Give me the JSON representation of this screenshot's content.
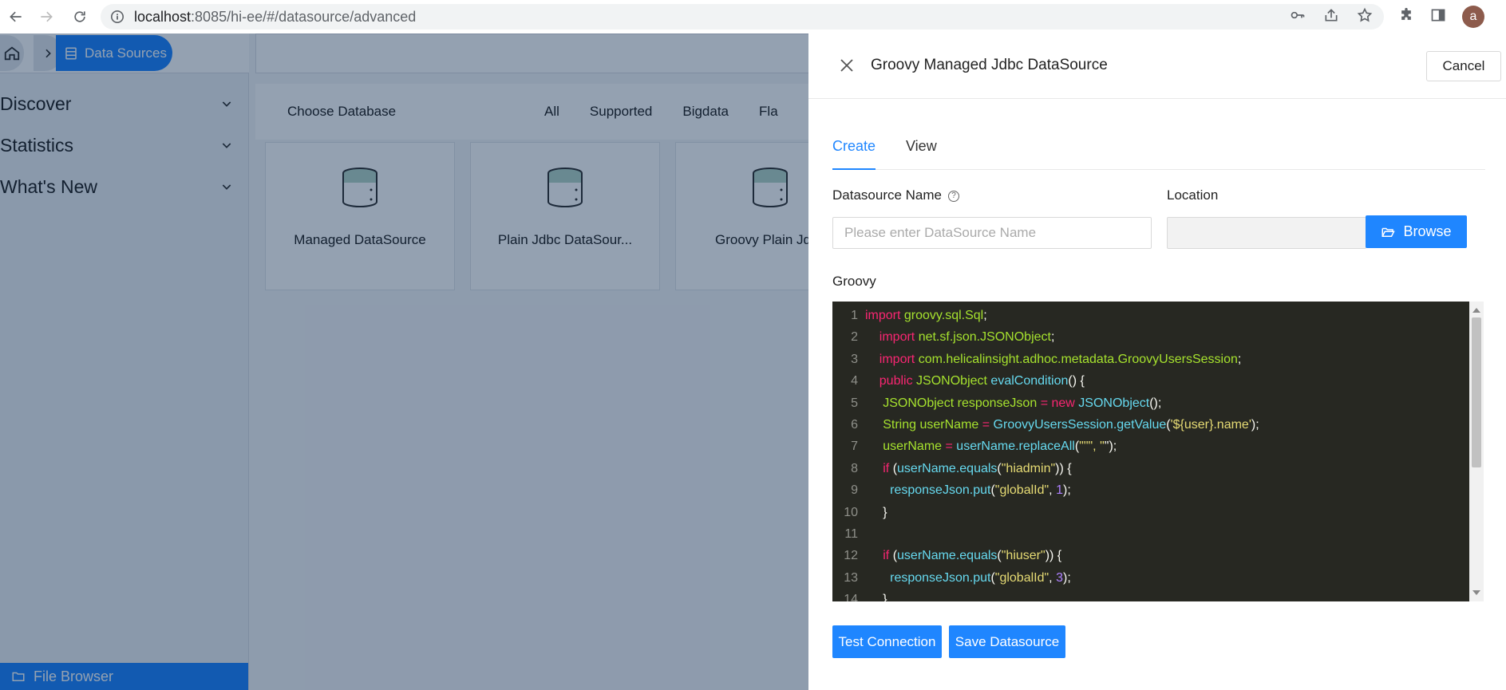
{
  "browser": {
    "url_host": "localhost",
    "url_path": ":8085/hi-ee/#/datasource/advanced",
    "profile_initial": "a"
  },
  "app": {
    "breadcrumb": {
      "active_label": "Data Sources"
    },
    "sidebar": {
      "items": [
        {
          "label": "Discover"
        },
        {
          "label": "Statistics"
        },
        {
          "label": "What's New"
        }
      ],
      "footer_label": "File Browser"
    },
    "main": {
      "choose_label": "Choose Database",
      "filters": [
        "All",
        "Supported",
        "Bigdata",
        "Fla"
      ],
      "cards": [
        {
          "name": "Managed DataSource"
        },
        {
          "name": "Plain Jdbc DataSour..."
        },
        {
          "name": "Groovy Plain Jdbc"
        }
      ]
    }
  },
  "drawer": {
    "title": "Groovy Managed Jdbc DataSource",
    "cancel_label": "Cancel",
    "tabs": [
      {
        "label": "Create",
        "active": true
      },
      {
        "label": "View",
        "active": false
      }
    ],
    "datasource_name_label": "Datasource Name",
    "datasource_name_placeholder": "Please enter DataSource Name",
    "location_label": "Location",
    "browse_label": "Browse",
    "groovy_label": "Groovy",
    "code_lines": [
      "import groovy.sql.Sql;",
      "    import net.sf.json.JSONObject;",
      "    import com.helicalinsight.adhoc.metadata.GroovyUsersSession;",
      "    public JSONObject evalCondition() {",
      "     JSONObject responseJson = new JSONObject();",
      "     String userName = GroovyUsersSession.getValue('${user}.name');",
      "     userName = userName.replaceAll(\"\"\", \"\");",
      "     if (userName.equals(\"hiadmin\")) {",
      "       responseJson.put(\"globalId\", 1);",
      "     }",
      "",
      "     if (userName.equals(\"hiuser\")) {",
      "       responseJson.put(\"globalId\", 3);",
      "     }"
    ],
    "test_connection_label": "Test Connection",
    "save_label": "Save Datasource"
  },
  "colors": {
    "primary": "#1f86ff",
    "editor_bg": "#272822",
    "keyword": "#f92672",
    "type": "#a6e22e",
    "function": "#66d9ef",
    "string": "#e6db74"
  }
}
